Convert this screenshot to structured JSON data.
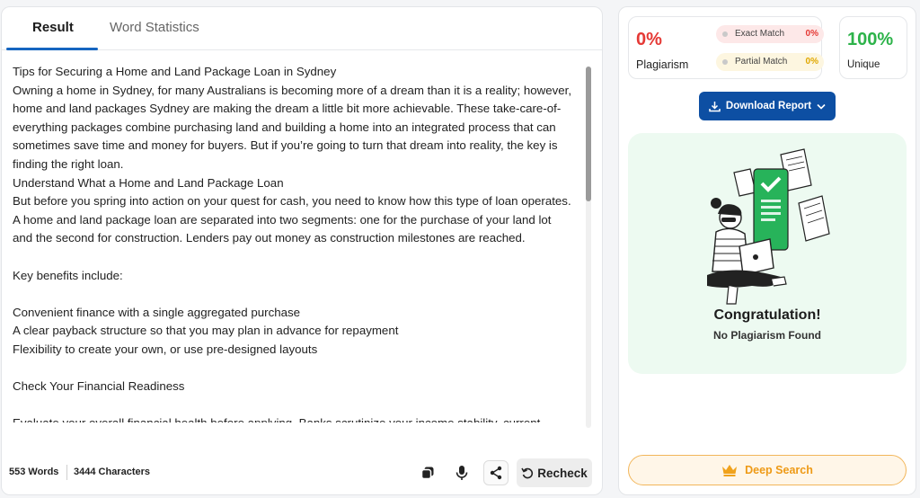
{
  "tabs": {
    "result": "Result",
    "word_statistics": "Word Statistics"
  },
  "content": {
    "lines": [
      "Tips for Securing a Home and Land Package Loan in Sydney",
      "Owning a home in Sydney, for many Australians is becoming more of a dream than it is a reality; however,",
      "home and land packages Sydney are making the dream a little bit more achievable. These take-care-of-",
      "everything packages combine purchasing land and building a home into an integrated process that can",
      "sometimes save time and money for buyers. But if you’re going to turn that dream into reality, the key is",
      "finding the right loan.",
      "Understand What a Home and Land Package Loan",
      "But before you spring into action on your quest for cash, you need to know how this type of loan operates.",
      "A home and land package loan are separated into two segments: one for the purchase of your land lot",
      "and the second for construction. Lenders pay out money as construction milestones are reached.",
      "",
      "Key benefits include:",
      "",
      "Convenient finance with a single aggregated purchase",
      "A clear payback structure so that you may plan in advance for repayment",
      "Flexibility to create your own, or use pre-designed layouts",
      "",
      "Check Your Financial Readiness",
      "",
      "Evaluate your overall financial health before applying. Banks scrutinize your income stability, current"
    ]
  },
  "footer": {
    "words": "553 Words",
    "characters": "3444 Characters",
    "recheck": "Recheck"
  },
  "stats": {
    "plagiarism_pct": "0%",
    "plagiarism_label": "Plagiarism",
    "exact_label": "Exact Match",
    "exact_value": "0%",
    "partial_label": "Partial Match",
    "partial_value": "0%",
    "unique_pct": "100%",
    "unique_label": "Unique"
  },
  "download": {
    "label": "Download Report"
  },
  "result": {
    "title": "Congratulation!",
    "subtitle": "No Plagiarism Found"
  },
  "deep_search": {
    "label": "Deep Search"
  },
  "colors": {
    "accent_blue": "#1565c0",
    "download_bg": "#0d4fa3",
    "plagiarism_red": "#e53935",
    "partial_yellow": "#e0a800",
    "unique_green": "#2db34a",
    "deep_search_orange": "#ee9a16"
  },
  "icons": [
    "copy-icon",
    "mic-icon",
    "share-icon",
    "recheck-icon",
    "download-icon",
    "chevron-down-icon",
    "crown-icon",
    "eye-icon"
  ]
}
